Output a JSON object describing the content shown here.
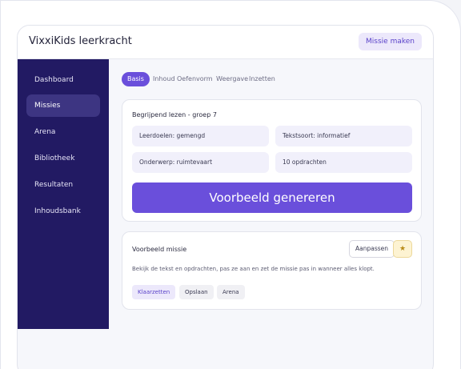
{
  "header": {
    "title": "VixxiKids leerkracht",
    "make_mission": "Missie maken"
  },
  "sidebar": {
    "items": [
      {
        "label": "Dashboard"
      },
      {
        "label": "Missies"
      },
      {
        "label": "Arena"
      },
      {
        "label": "Bibliotheek"
      },
      {
        "label": "Resultaten"
      },
      {
        "label": "Inhoudsbank"
      }
    ]
  },
  "tabs": [
    {
      "label": "Basis"
    },
    {
      "label": "Inhoud"
    },
    {
      "label": "Oefenvorm"
    },
    {
      "label": "Weergave"
    },
    {
      "label": "Inzetten"
    }
  ],
  "config": {
    "title": "Begrijpend lezen - groep 7",
    "learning_goals": "Leerdoelen: gemengd",
    "text_type": "Tekstsoort: informatief",
    "subject": "Onderwerp: ruimtevaart",
    "assignments": "10 opdrachten",
    "generate": "Voorbeeld genereren"
  },
  "preview": {
    "title": "Voorbeeld missie",
    "adjust": "Aanpassen",
    "star": "★",
    "description": "Bekijk de tekst en opdrachten, pas ze aan en zet de missie pas in wanneer alles klopt.",
    "actions": [
      {
        "label": "Klaarzetten"
      },
      {
        "label": "Opslaan"
      },
      {
        "label": "Arena"
      }
    ]
  }
}
